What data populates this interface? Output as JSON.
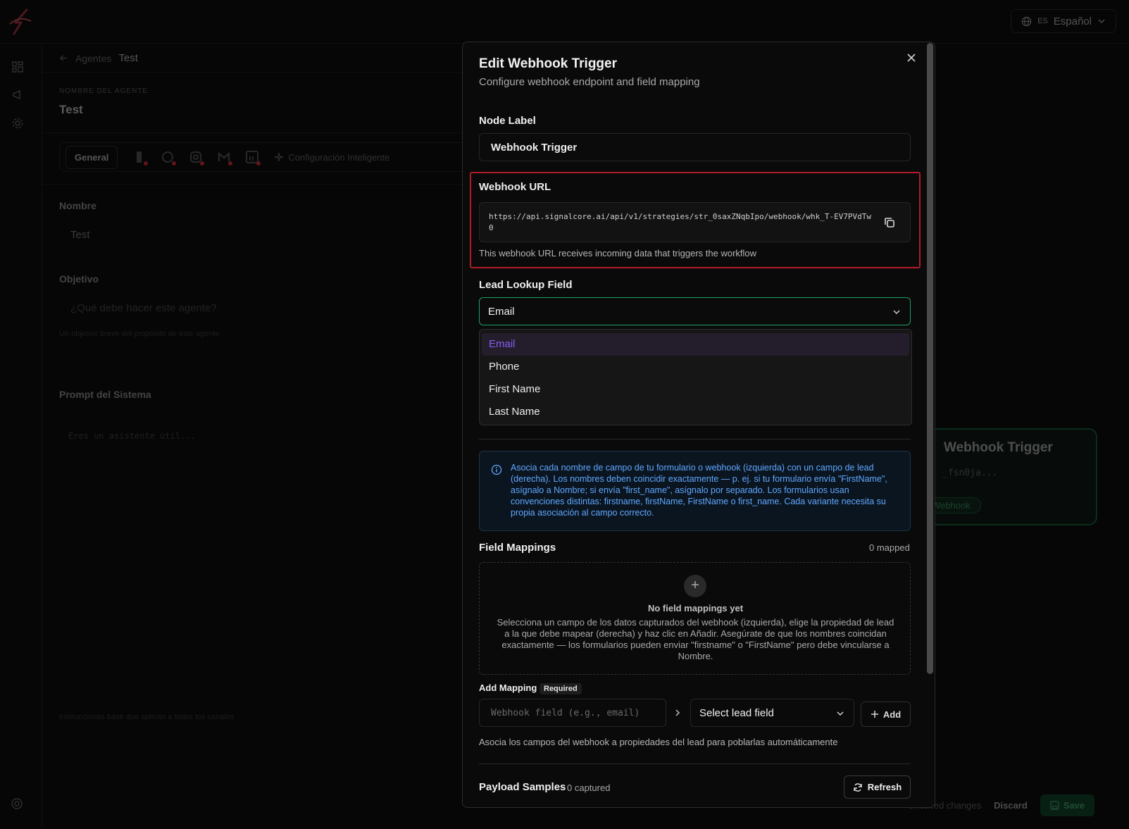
{
  "topbar": {
    "lang_code": "ES",
    "lang_label": "Español"
  },
  "breadcrumb": {
    "parent": "Agentes",
    "current": "Test"
  },
  "agent": {
    "caption": "NOMBRE DEL AGENTE",
    "name": "Test"
  },
  "tabs": {
    "general": "General",
    "smart_config": "Configuración Inteligente"
  },
  "form": {
    "name_label": "Nombre",
    "name_value": "Test",
    "goal_label": "Objetivo",
    "goal_placeholder": "¿Qué debe hacer este agente?",
    "goal_help": "Un objetivo breve del propósito de este agente",
    "prompt_label": "Prompt del Sistema",
    "prompt_placeholder": "Eres un asistente útil...",
    "prompt_help": "Instrucciones base que aplican a todos los canales"
  },
  "canvas_node": {
    "title": "Webhook Trigger",
    "subtitle": "_fsn0ja...",
    "chip": "Webhook"
  },
  "bottom_bar": {
    "unsaved": "Unsaved changes",
    "discard": "Discard",
    "save": "Save"
  },
  "modal": {
    "title": "Edit Webhook Trigger",
    "subtitle": "Configure webhook endpoint and field mapping",
    "node_label": "Node Label",
    "node_label_value": "Webhook Trigger",
    "webhook_url_label": "Webhook URL",
    "webhook_url": "https://api.signalcore.ai/api/v1/strategies/str_0saxZNqbIpo/webhook/whk_T-EV7PVdTw0",
    "webhook_url_help": "This webhook URL receives incoming data that triggers the workflow",
    "lead_lookup_label": "Lead Lookup Field",
    "lead_lookup_value": "Email",
    "lead_lookup_options": [
      "Email",
      "Phone",
      "First Name",
      "Last Name"
    ],
    "info_text": "Asocia cada nombre de campo de tu formulario o webhook (izquierda) con un campo de lead (derecha). Los nombres deben coincidir exactamente — p. ej. si tu formulario envía \"FirstName\", asígnalo a Nombre; si envía \"first_name\", asígnalo por separado. Los formularios usan convenciones distintas: firstname, firstName, FirstName o first_name. Cada variante necesita su propia asociación al campo correcto.",
    "field_mappings_label": "Field Mappings",
    "field_mappings_count": "0 mapped",
    "empty_title": "No field mappings yet",
    "empty_text": "Selecciona un campo de los datos capturados del webhook (izquierda), elige la propiedad de lead a la que debe mapear (derecha) y haz clic en Añadir. Asegúrate de que los nombres coincidan exactamente — los formularios pueden enviar \"firstname\" o \"FirstName\" pero debe vincularse a Nombre.",
    "add_mapping_label": "Add Mapping",
    "required_badge": "Required",
    "webhook_field_placeholder": "Webhook field (e.g., email)",
    "lead_field_placeholder": "Select lead field",
    "add_button": "Add",
    "mapping_help": "Asocia los campos del webhook a propiedades del lead para poblarlas automáticamente",
    "payload_label": "Payload Samples",
    "payload_count": "0 captured",
    "refresh_button": "Refresh"
  },
  "colors": {
    "accent_green": "#1e9e68",
    "highlight_red": "#b01c2a",
    "option_purple": "#8b5cf6",
    "info_blue": "#5fa8ff"
  }
}
